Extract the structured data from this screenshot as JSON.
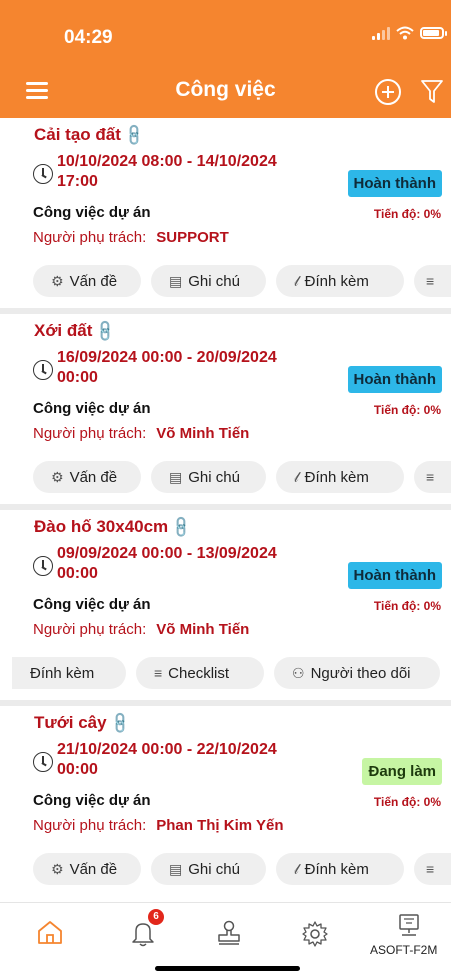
{
  "status_bar": {
    "time": "04:29"
  },
  "header": {
    "title": "Công việc"
  },
  "colors": {
    "header_bg": "#f5852f",
    "title_red": "#b5121b",
    "done_badge": "#2db7e8",
    "progress_badge": "#c6f5a3"
  },
  "tasks": [
    {
      "title": "Cải tạo đất",
      "date_line1": "10/10/2024 08:00 - 14/10/2024",
      "date_line2": "17:00",
      "status": "Hoàn thành",
      "type": "Công việc dự án",
      "progress": "Tiến độ: 0%",
      "owner_label": "Người phụ trách:",
      "owner_name": "SUPPORT",
      "chips": [
        "Vấn đề",
        "Ghi chú",
        "Đính kèm"
      ]
    },
    {
      "title": "Xới đất",
      "date_line1": "16/09/2024 00:00 - 20/09/2024",
      "date_line2": "00:00",
      "status": "Hoàn thành",
      "type": "Công việc dự án",
      "progress": "Tiến độ: 0%",
      "owner_label": "Người phụ trách:",
      "owner_name": "Võ Minh Tiến",
      "chips": [
        "Vấn đề",
        "Ghi chú",
        "Đính kèm"
      ]
    },
    {
      "title": "Đào hố 30x40cm",
      "date_line1": "09/09/2024 00:00 - 13/09/2024",
      "date_line2": "00:00",
      "status": "Hoàn thành",
      "type": "Công việc dự án",
      "progress": "Tiến độ: 0%",
      "owner_label": "Người phụ trách:",
      "owner_name": "Võ Minh Tiến",
      "chips": [
        "Đính kèm",
        "Checklist",
        "Người theo dõi"
      ]
    },
    {
      "title": "Tưới cây",
      "date_line1": "21/10/2024 00:00 - 22/10/2024",
      "date_line2": "00:00",
      "status": "Đang làm",
      "type": "Công việc dự án",
      "progress": "Tiến độ: 0%",
      "owner_label": "Người phụ trách:",
      "owner_name": "Phan Thị Kim Yến",
      "chips": [
        "Vấn đề",
        "Ghi chú",
        "Đính kèm"
      ]
    }
  ],
  "tabbar": {
    "notification_count": "6",
    "last_label": "ASOFT-F2M"
  }
}
